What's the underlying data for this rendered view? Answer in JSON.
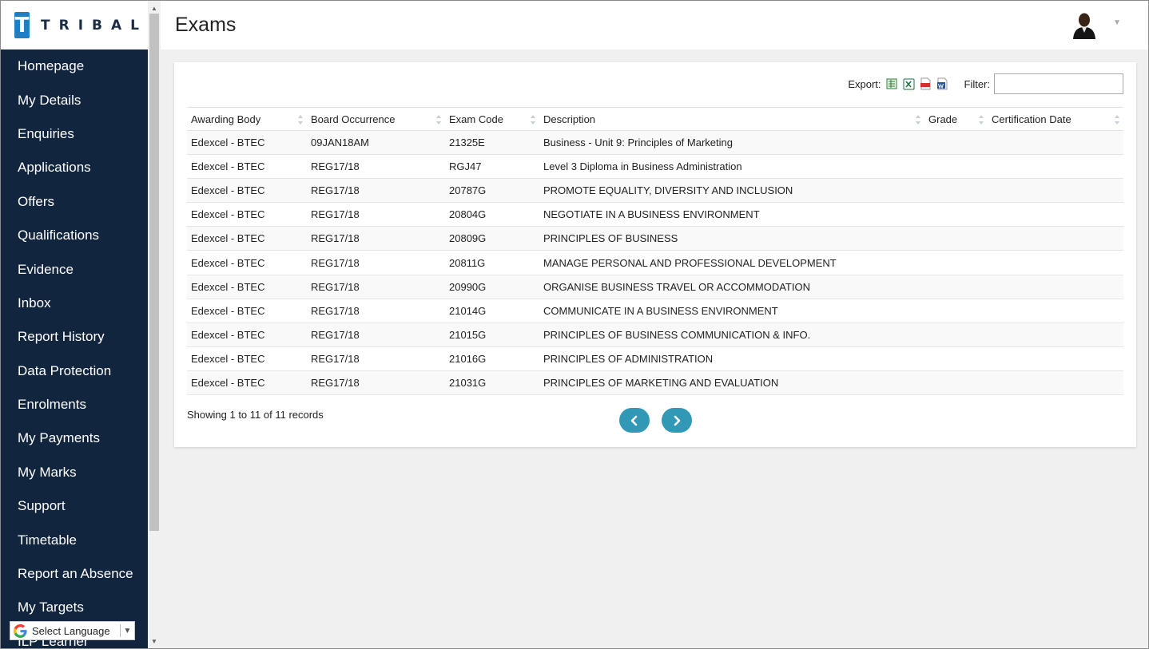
{
  "brand": {
    "logo_letter": "T",
    "logo_word": "TRIBAL"
  },
  "page": {
    "title": "Exams"
  },
  "sidebar": {
    "items": [
      {
        "label": "Homepage"
      },
      {
        "label": "My Details"
      },
      {
        "label": "Enquiries"
      },
      {
        "label": "Applications"
      },
      {
        "label": "Offers"
      },
      {
        "label": "Qualifications"
      },
      {
        "label": "Evidence"
      },
      {
        "label": "Inbox"
      },
      {
        "label": "Report History"
      },
      {
        "label": "Data Protection"
      },
      {
        "label": "Enrolments"
      },
      {
        "label": "My Payments"
      },
      {
        "label": "My Marks"
      },
      {
        "label": "Support"
      },
      {
        "label": "Timetable"
      },
      {
        "label": "Report an Absence"
      },
      {
        "label": "My Targets"
      },
      {
        "label": "ILP Learner"
      }
    ]
  },
  "language": {
    "label": "Select Language",
    "caret": "▼"
  },
  "toolbar": {
    "export_label": "Export:",
    "filter_label": "Filter:",
    "filter_value": ""
  },
  "table": {
    "columns": [
      "Awarding Body",
      "Board Occurrence",
      "Exam Code",
      "Description",
      "Grade",
      "Certification Date"
    ],
    "rows": [
      [
        "Edexcel - BTEC",
        "09JAN18AM",
        "21325E",
        "Business - Unit 9: Principles of Marketing",
        "",
        ""
      ],
      [
        "Edexcel - BTEC",
        "REG17/18",
        "RGJ47",
        "Level 3 Diploma in Business Administration",
        "",
        ""
      ],
      [
        "Edexcel - BTEC",
        "REG17/18",
        "20787G",
        "PROMOTE EQUALITY, DIVERSITY AND INCLUSION",
        "",
        ""
      ],
      [
        "Edexcel - BTEC",
        "REG17/18",
        "20804G",
        "NEGOTIATE IN A BUSINESS ENVIRONMENT",
        "",
        ""
      ],
      [
        "Edexcel - BTEC",
        "REG17/18",
        "20809G",
        "PRINCIPLES OF BUSINESS",
        "",
        ""
      ],
      [
        "Edexcel - BTEC",
        "REG17/18",
        "20811G",
        "MANAGE PERSONAL AND PROFESSIONAL DEVELOPMENT",
        "",
        ""
      ],
      [
        "Edexcel - BTEC",
        "REG17/18",
        "20990G",
        "ORGANISE BUSINESS TRAVEL OR ACCOMMODATION",
        "",
        ""
      ],
      [
        "Edexcel - BTEC",
        "REG17/18",
        "21014G",
        "COMMUNICATE IN A BUSINESS ENVIRONMENT",
        "",
        ""
      ],
      [
        "Edexcel - BTEC",
        "REG17/18",
        "21015G",
        "PRINCIPLES OF BUSINESS COMMUNICATION & INFO.",
        "",
        ""
      ],
      [
        "Edexcel - BTEC",
        "REG17/18",
        "21016G",
        "PRINCIPLES OF ADMINISTRATION",
        "",
        ""
      ],
      [
        "Edexcel - BTEC",
        "REG17/18",
        "21031G",
        "PRINCIPLES OF MARKETING AND EVALUATION",
        "",
        ""
      ]
    ]
  },
  "pagination": {
    "summary": "Showing 1 to 11 of 11 records"
  },
  "colors": {
    "sidebar_bg": "#11253e",
    "accent": "#3198b6",
    "logo_blue": "#1f7fc0"
  }
}
